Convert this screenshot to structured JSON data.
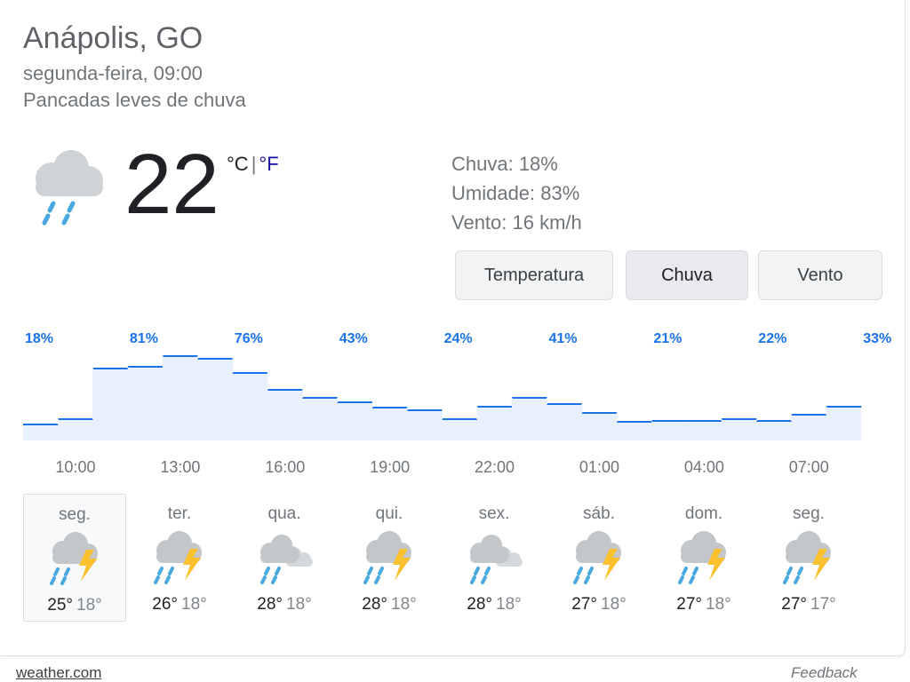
{
  "header": {
    "location": "Anápolis, GO",
    "datetime": "segunda-feira, 09:00",
    "condition": "Pancadas leves de chuva"
  },
  "current": {
    "temperature": "22",
    "unit_c": "°C",
    "unit_separator": "|",
    "unit_f": "°F",
    "icon": "rain-cloud-icon",
    "details": {
      "rain": "Chuva: 18%",
      "humidity": "Umidade: 83%",
      "wind": "Vento: 16 km/h"
    }
  },
  "tabs": [
    {
      "label": "Temperatura",
      "active": false
    },
    {
      "label": "Chuva",
      "active": true
    },
    {
      "label": "Vento",
      "active": false
    }
  ],
  "chart_data": {
    "type": "area",
    "series_name": "Chuva",
    "unit": "%",
    "hours": [
      "10:00",
      "11:00",
      "12:00",
      "13:00",
      "14:00",
      "15:00",
      "16:00",
      "17:00",
      "18:00",
      "19:00",
      "20:00",
      "21:00",
      "22:00",
      "23:00",
      "00:00",
      "01:00",
      "02:00",
      "03:00",
      "04:00",
      "05:00",
      "06:00",
      "07:00",
      "08:00",
      "09:00"
    ],
    "values": [
      18,
      24,
      81,
      83,
      95,
      92,
      76,
      57,
      48,
      43,
      37,
      34,
      24,
      38,
      48,
      41,
      31,
      21,
      22,
      22,
      24,
      22,
      29,
      38
    ],
    "tick_labels": [
      "10:00",
      "13:00",
      "16:00",
      "19:00",
      "22:00",
      "01:00",
      "04:00",
      "07:00"
    ],
    "value_labels": [
      "18%",
      "81%",
      "76%",
      "43%",
      "24%",
      "41%",
      "21%",
      "22%",
      "33%"
    ],
    "ylim": [
      0,
      100
    ],
    "colors": {
      "line": "#1a73e8",
      "fill": "#e8f0fe",
      "label": "#1a73e8",
      "tick": "#70757a"
    }
  },
  "forecast": [
    {
      "day": "seg.",
      "high": "25°",
      "low": "18°",
      "icon": "thunderstorm-icon",
      "selected": true
    },
    {
      "day": "ter.",
      "high": "26°",
      "low": "18°",
      "icon": "thunderstorm-icon",
      "selected": false
    },
    {
      "day": "qua.",
      "high": "28°",
      "low": "18°",
      "icon": "rain-cloudy-icon",
      "selected": false
    },
    {
      "day": "qui.",
      "high": "28°",
      "low": "18°",
      "icon": "thunderstorm-icon",
      "selected": false
    },
    {
      "day": "sex.",
      "high": "28°",
      "low": "18°",
      "icon": "rain-cloudy-icon",
      "selected": false
    },
    {
      "day": "sáb.",
      "high": "27°",
      "low": "18°",
      "icon": "thunderstorm-icon",
      "selected": false
    },
    {
      "day": "dom.",
      "high": "27°",
      "low": "18°",
      "icon": "thunderstorm-icon",
      "selected": false
    },
    {
      "day": "seg.",
      "high": "27°",
      "low": "17°",
      "icon": "thunderstorm-icon",
      "selected": false
    }
  ],
  "footer": {
    "source": "weather.com",
    "feedback": "Feedback"
  }
}
